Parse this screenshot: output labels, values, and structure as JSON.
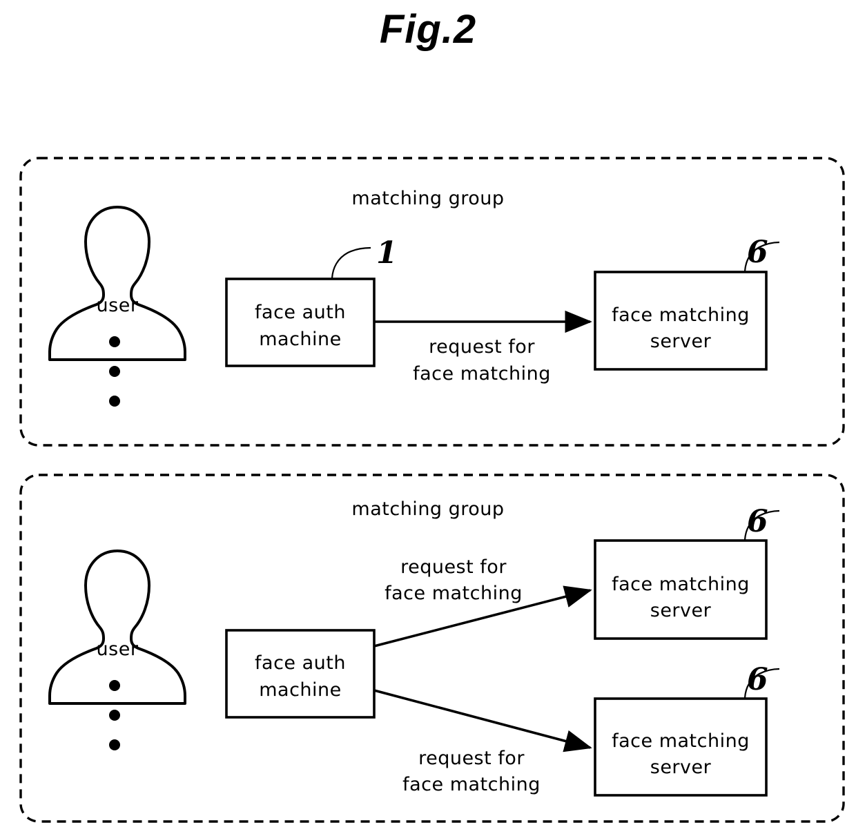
{
  "figure": {
    "title": "Fig.2"
  },
  "panels": [
    {
      "name": "top-panel",
      "group_label": "matching group",
      "user": {
        "label": "user",
        "ellipsis_dots": 3
      },
      "client": {
        "label_line1": "face  auth",
        "label_line2": "machine",
        "reference": "1"
      },
      "flows": [
        {
          "label_line1": "request  for",
          "label_line2": "face  matching"
        }
      ],
      "servers": [
        {
          "label_line1": "face  matching",
          "label_line2": "server",
          "reference": "6"
        }
      ]
    },
    {
      "name": "bottom-panel",
      "group_label": "matching group",
      "user": {
        "label": "user",
        "ellipsis_dots": 3
      },
      "client": {
        "label_line1": "face  auth",
        "label_line2": "machine",
        "reference": ""
      },
      "flows": [
        {
          "label_line1": "request  for",
          "label_line2": "face  matching"
        },
        {
          "label_line1": "request  for",
          "label_line2": "face  matching"
        }
      ],
      "servers": [
        {
          "label_line1": "face  matching",
          "label_line2": "server",
          "reference": "6"
        },
        {
          "label_line1": "face  matching",
          "label_line2": "server",
          "reference": "6"
        }
      ]
    }
  ],
  "colors": {
    "ink": "#000000",
    "paper": "#ffffff"
  }
}
